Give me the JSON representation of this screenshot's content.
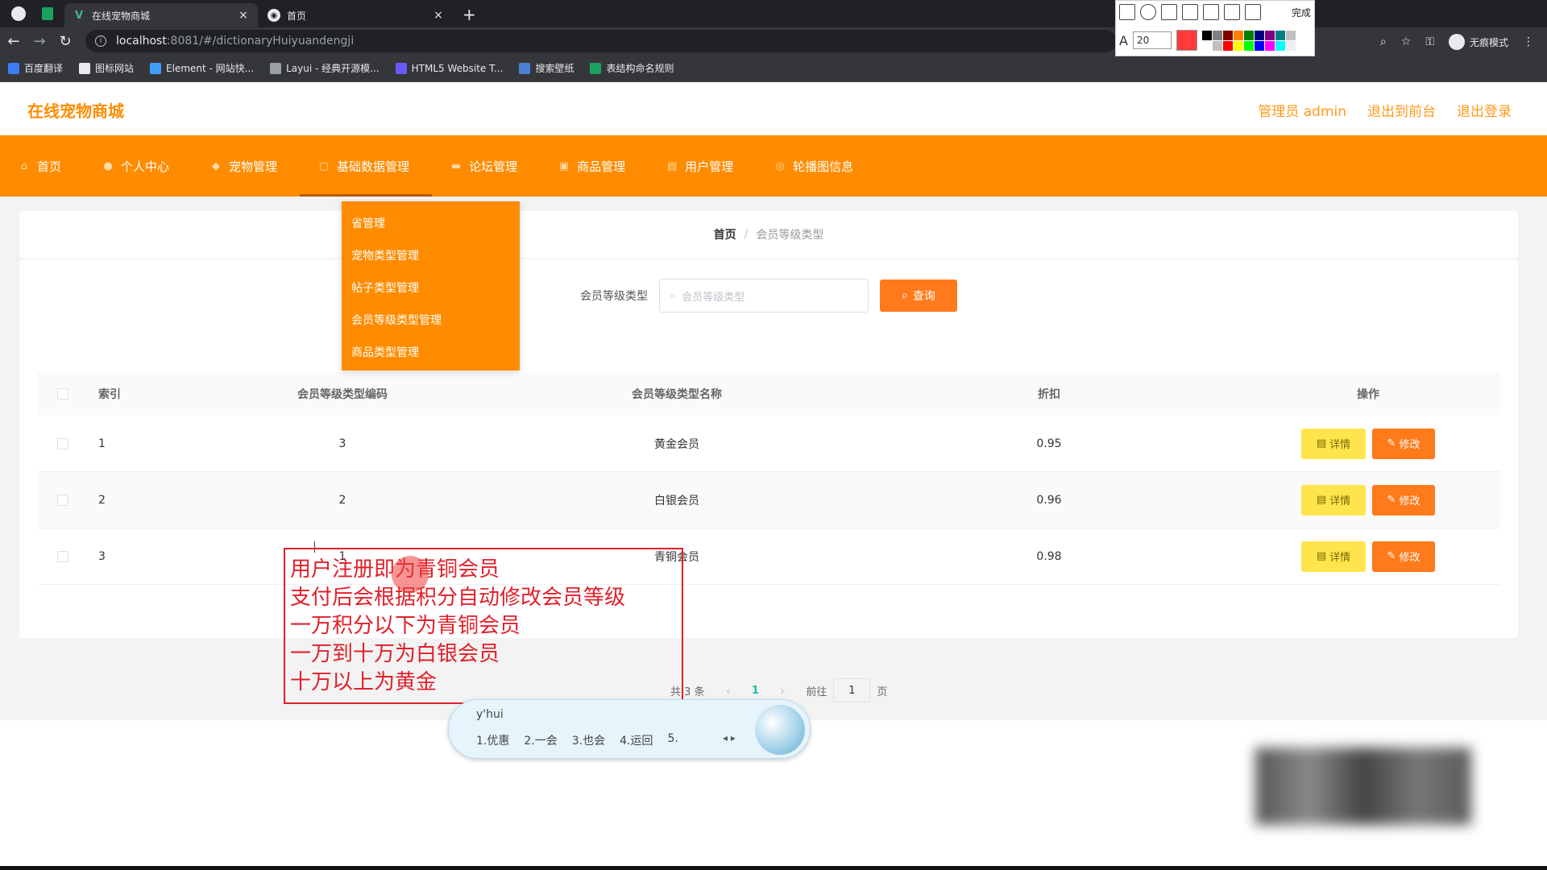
{
  "browser": {
    "tabs": [
      {
        "title": "在线宠物商城",
        "active": true
      },
      {
        "title": "首页",
        "active": false
      }
    ],
    "url_host": "localhost",
    "url_path": ":8081/#/dictionaryHuiyuandengji",
    "incognito_label": "无痕模式",
    "bookmarks": [
      "百度翻译",
      "图标网站",
      "Element - 网站快...",
      "Layui - 经典开源模...",
      "HTML5 Website T...",
      "搜索壁纸",
      "表结构命名规则"
    ]
  },
  "snip_tool": {
    "font_size": "20",
    "done_label": "完成"
  },
  "app": {
    "brand": "在线宠物商城",
    "header_links": [
      "管理员 admin",
      "退出到前台",
      "退出登录"
    ],
    "menu": [
      "首页",
      "个人中心",
      "宠物管理",
      "基础数据管理",
      "论坛管理",
      "商品管理",
      "用户管理",
      "轮播图信息"
    ],
    "dropdown": [
      "省管理",
      "宠物类型管理",
      "帖子类型管理",
      "会员等级类型管理",
      "商品类型管理"
    ],
    "breadcrumb": {
      "home": "首页",
      "separator": "/",
      "current": "会员等级类型"
    },
    "search": {
      "label": "会员等级类型",
      "placeholder": "会员等级类型",
      "button": "查询"
    },
    "table": {
      "headers": {
        "index": "索引",
        "code": "会员等级类型编码",
        "name": "会员等级类型名称",
        "discount": "折扣",
        "ops": "操作"
      },
      "rows": [
        {
          "index": "1",
          "code": "3",
          "name": "黄金会员",
          "discount": "0.95"
        },
        {
          "index": "2",
          "code": "2",
          "name": "白银会员",
          "discount": "0.96"
        },
        {
          "index": "3",
          "code": "1",
          "name": "青铜会员",
          "discount": "0.98"
        }
      ],
      "detail_label": "详情",
      "edit_label": "修改"
    },
    "pager": {
      "total": "共 3 条",
      "page": "1",
      "goto_prefix": "前往",
      "goto_value": "1",
      "goto_suffix": "页"
    }
  },
  "annotation": {
    "lines": [
      "用户注册即为青铜会员",
      "支付后会根据积分自动修改会员等级",
      "一万积分以下为青铜会员",
      "一万到十万为白银会员",
      "十万以上为黄金"
    ]
  },
  "ime": {
    "input": "y'hui",
    "candidates": [
      "1.优惠",
      "2.一会",
      "3.也会",
      "4.运回",
      "5."
    ]
  },
  "colors": {
    "accent": "#ff8c00",
    "button_query": "#ff7a1a",
    "detail_button": "#ffe44d",
    "annotation": "#e0202a"
  }
}
